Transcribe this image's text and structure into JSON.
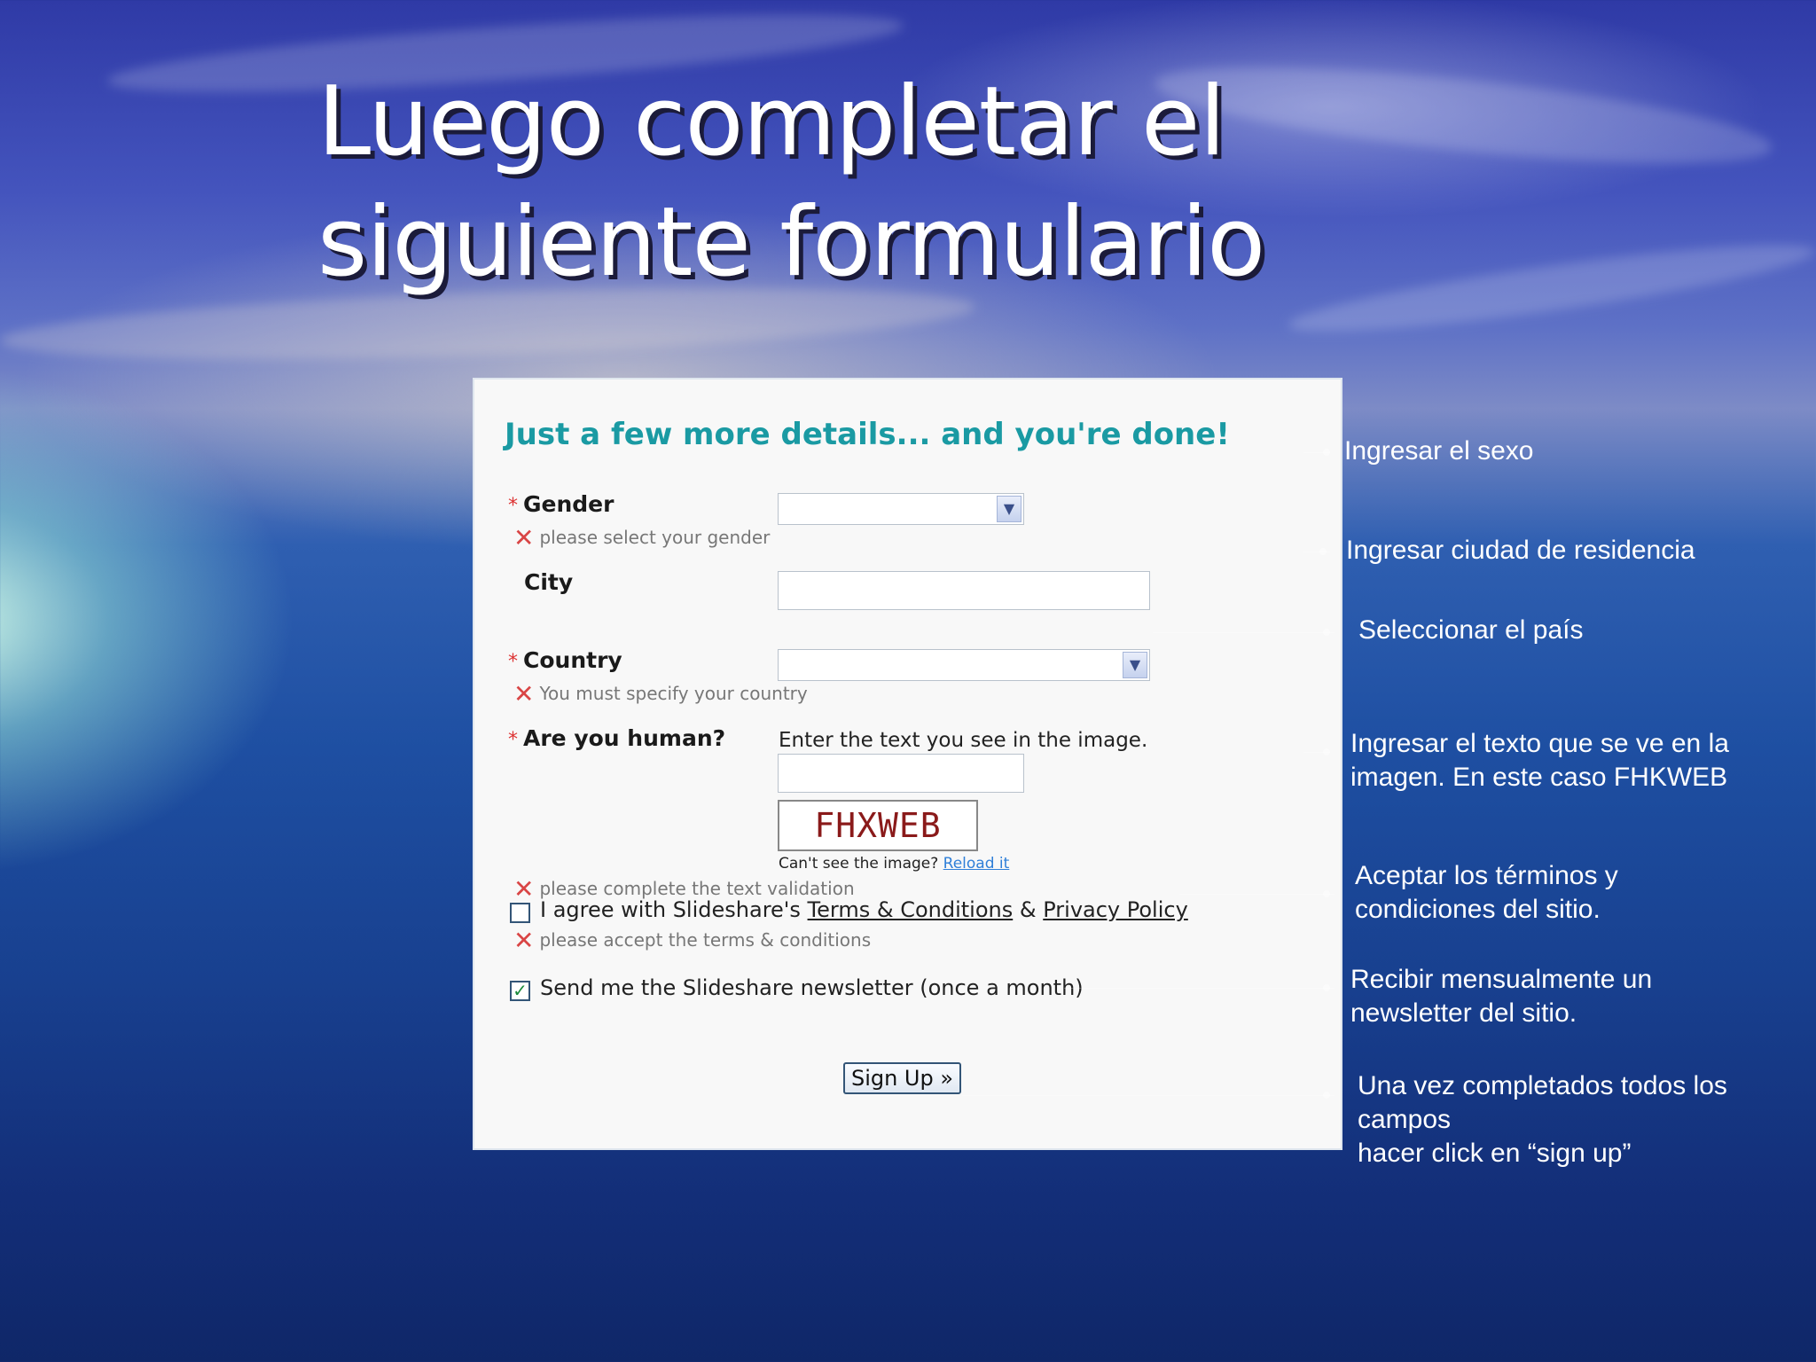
{
  "slide": {
    "title_lines": [
      "Luego completar el",
      "siguiente formulario"
    ]
  },
  "form": {
    "heading": "Just a few more details... and you're done!",
    "gender": {
      "label": "Gender",
      "required_mark": "*",
      "error": "please select your gender"
    },
    "city": {
      "label": "City"
    },
    "country": {
      "label": "Country",
      "required_mark": "*",
      "error": "You must specify your country"
    },
    "human": {
      "label": "Are you human?",
      "required_mark": "*",
      "instruction": "Enter the text you see in the image.",
      "captcha_text": "FHXWEB",
      "cant_see": "Can't see the image?",
      "reload_link": "Reload it",
      "error": "please complete the text validation"
    },
    "terms": {
      "prefix": "I agree with Slideshare's",
      "terms_link": "Terms & Conditions",
      "amp": "&",
      "privacy_link": "Privacy Policy",
      "checked": false,
      "error": "please accept the terms & conditions"
    },
    "newsletter": {
      "label": "Send me the Slideshare newsletter (once a month)",
      "checked": true
    },
    "signup_button": "Sign Up »"
  },
  "notes": {
    "gender": [
      "Ingresar el sexo"
    ],
    "city": [
      "Ingresar ciudad de residencia"
    ],
    "country": [
      "Seleccionar el país"
    ],
    "captcha": [
      "Ingresar el texto que se ve en la",
      "imagen. En este caso FHKWEB"
    ],
    "terms": [
      "Aceptar los términos y",
      "condiciones del sitio."
    ],
    "newsletter": [
      "Recibir mensualmente un",
      "newsletter del sitio."
    ],
    "signup": [
      "Una vez completados todos los",
      "campos",
      "hacer click en “sign up”"
    ]
  },
  "icons": {
    "error": "close-x-icon",
    "dropdown": "chevron-down-icon",
    "check": "check-icon"
  },
  "colors": {
    "heading": "#1a9aa3",
    "error_x": "#d94545",
    "link": "#2f7fd8",
    "required": "#dd3333"
  }
}
